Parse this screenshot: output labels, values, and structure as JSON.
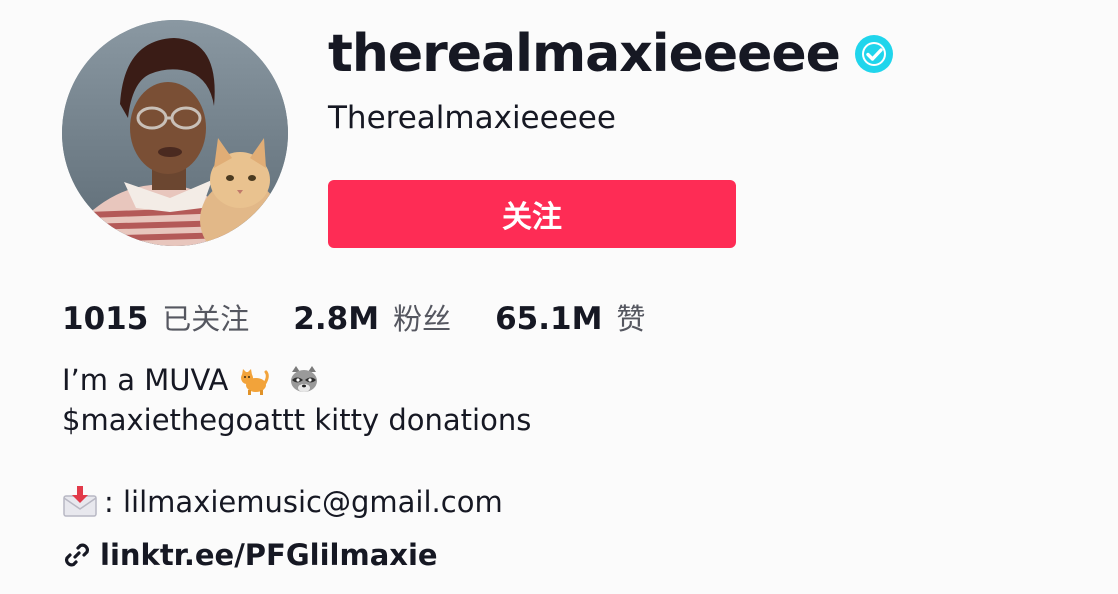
{
  "profile": {
    "username": "therealmaxieeeee",
    "nickname": "Therealmaxieeeee",
    "verified": true,
    "follow_button_label": "关注"
  },
  "stats": {
    "following": {
      "value": "1015",
      "label": "已关注"
    },
    "followers": {
      "value": "2.8M",
      "label": "粉丝"
    },
    "likes": {
      "value": "65.1M",
      "label": "赞"
    }
  },
  "bio": {
    "line1": "I’m a MUVA",
    "line1_emojis": [
      "cat-emoji",
      "raccoon-emoji"
    ],
    "line2": "$maxiethegoattt kitty donations",
    "contact_prefix": ": ",
    "email": "lilmaxiemusic@gmail.com"
  },
  "link": {
    "text": "linktr.ee/PFGlilmaxie"
  },
  "colors": {
    "accent": "#fe2c55",
    "verified": "#20d5ec",
    "text_primary": "#161823",
    "text_secondary": "#555760",
    "background": "#fbfbfb"
  }
}
